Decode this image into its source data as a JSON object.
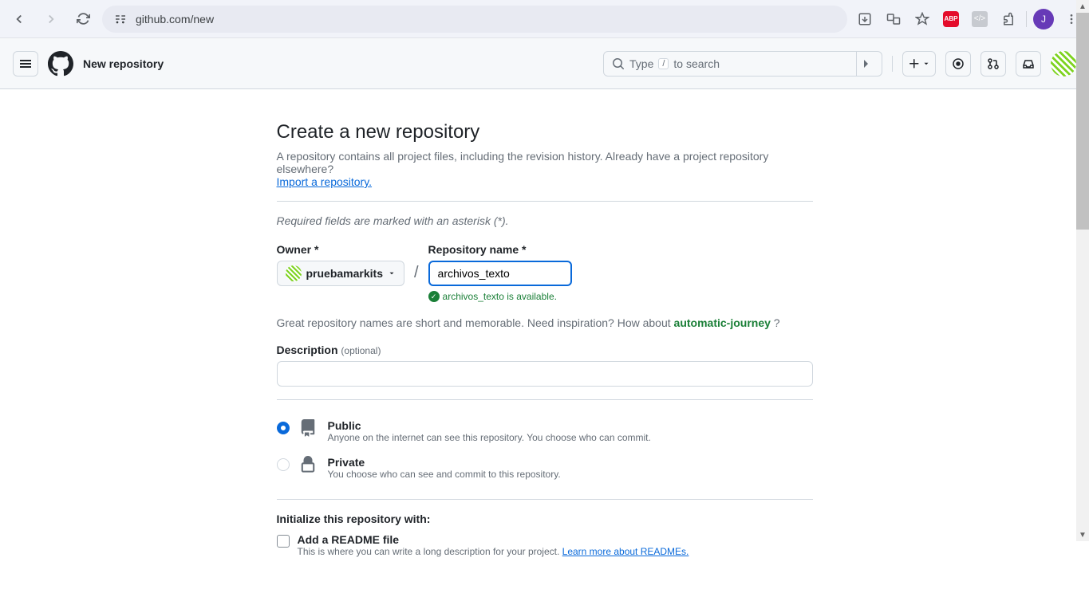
{
  "browser": {
    "url": "github.com/new",
    "profile_initial": "J"
  },
  "header": {
    "title": "New repository",
    "search_prefix": "Type",
    "search_kbd": "/",
    "search_suffix": "to search"
  },
  "page": {
    "title": "Create a new repository",
    "description": "A repository contains all project files, including the revision history. Already have a project repository elsewhere?",
    "import_link": "Import a repository.",
    "required_note": "Required fields are marked with an asterisk (*)."
  },
  "form": {
    "owner_label": "Owner *",
    "owner_value": "pruebamarkits",
    "repo_label": "Repository name *",
    "repo_value": "archivos_texto",
    "availability_text": "archivos_texto is available.",
    "inspiration_text": "Great repository names are short and memorable. Need inspiration? How about ",
    "suggestion": "automatic-journey",
    "question_mark": " ?",
    "description_label": "Description",
    "optional_text": "(optional)"
  },
  "visibility": {
    "public": {
      "title": "Public",
      "desc": "Anyone on the internet can see this repository. You choose who can commit."
    },
    "private": {
      "title": "Private",
      "desc": "You choose who can see and commit to this repository."
    }
  },
  "initialize": {
    "title": "Initialize this repository with:",
    "readme_title": "Add a README file",
    "readme_desc": "This is where you can write a long description for your project. ",
    "readme_link": "Learn more about READMEs."
  }
}
